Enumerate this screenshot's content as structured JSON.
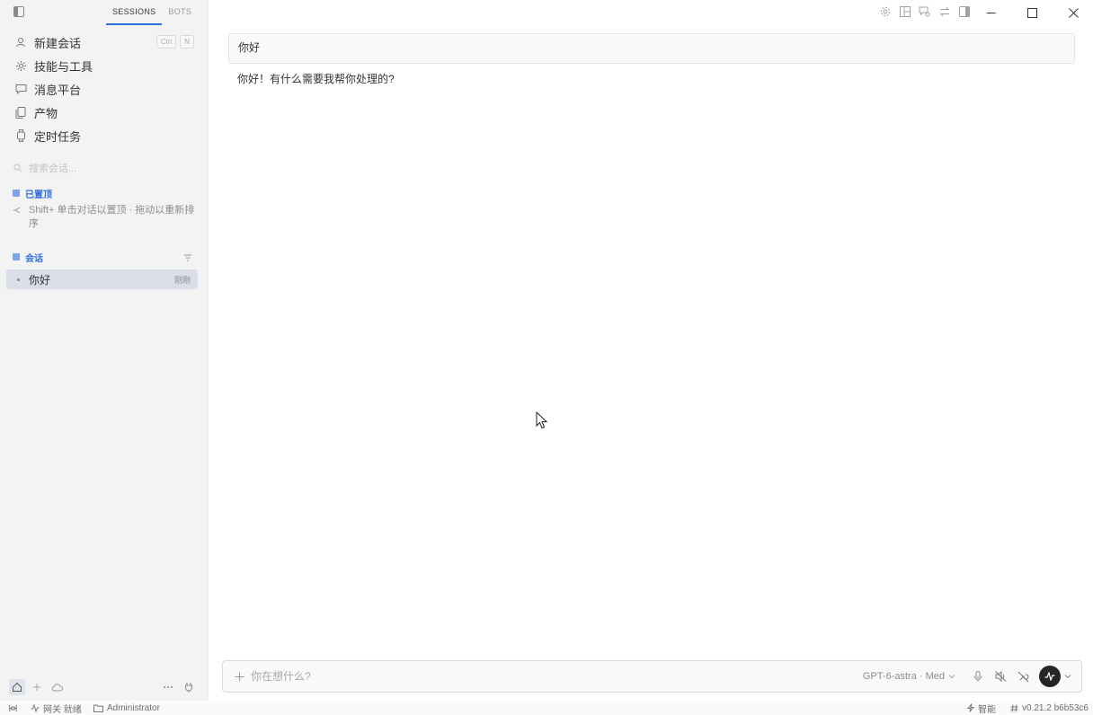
{
  "sidebar": {
    "tabs": [
      {
        "label": "SESSIONS",
        "active": true
      },
      {
        "label": "BOTS",
        "active": false
      }
    ],
    "nav": [
      {
        "label": "新建会话",
        "icon": "person-icon"
      },
      {
        "label": "技能与工具",
        "icon": "tools-icon"
      },
      {
        "label": "消息平台",
        "icon": "chat-bubble-icon"
      },
      {
        "label": "产物",
        "icon": "files-icon"
      },
      {
        "label": "定时任务",
        "icon": "watch-icon"
      }
    ],
    "shortcut": {
      "key1": "Ctrl",
      "key2": "N"
    },
    "search_placeholder": "搜索会话...",
    "pinned": {
      "title": "已置顶",
      "hint": "Shift+ 单击对话以置顶 · 拖动以重新排序"
    },
    "sessions": {
      "title": "会话",
      "items": [
        {
          "name": "你好",
          "time": "刚刚"
        }
      ]
    }
  },
  "chat": {
    "user_message": "你好",
    "bot_message": "你好！有什么需要我帮你处理的?"
  },
  "composer": {
    "placeholder": "你在想什么?",
    "model": "GPT-6-astra · Med"
  },
  "statusbar": {
    "gateway": "网关 就绪",
    "user": "Administrator",
    "mode": "智能",
    "version": "v0.21.2 b6b53c6"
  },
  "colors": {
    "accent": "#2f6fe0",
    "sidebar_bg": "#f3f3f3",
    "selected_session_bg": "#d9dee8"
  }
}
